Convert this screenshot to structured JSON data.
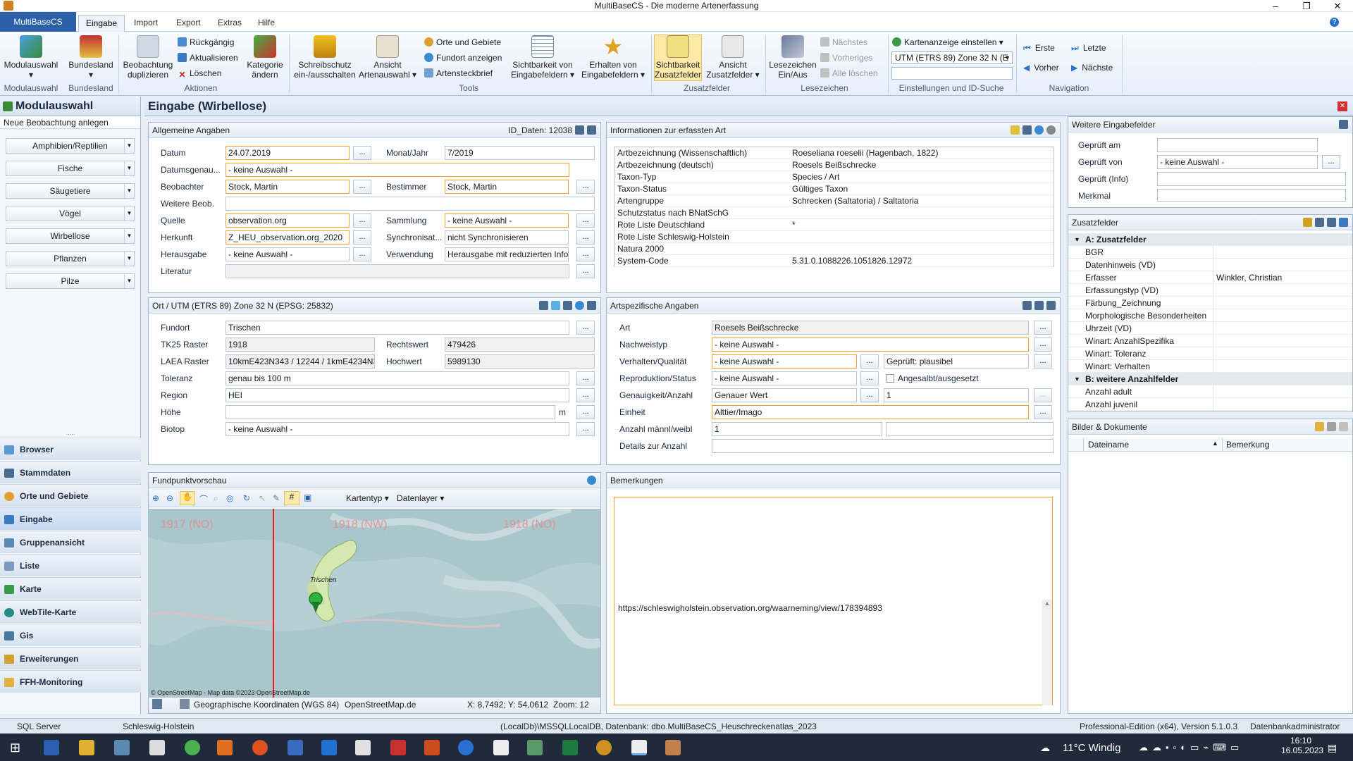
{
  "window": {
    "title": "MultiBaseCS - Die moderne Artenerfassung"
  },
  "ribbon": {
    "file_tab": "MultiBaseCS",
    "tabs": [
      "Eingabe",
      "Import",
      "Export",
      "Extras",
      "Hilfe"
    ],
    "buttons": {
      "modulauswahl": "Modulauswahl",
      "bundesland": "Bundesland",
      "duplizieren_1": "Beobachtung",
      "duplizieren_2": "duplizieren",
      "rueckgaengig": "Rückgängig",
      "aktualisieren": "Aktualisieren",
      "loeschen": "Löschen",
      "kategorie_1": "Kategorie",
      "kategorie_2": "ändern",
      "schreibschutz_1": "Schreibschutz",
      "schreibschutz_2": "ein-/ausschalten",
      "artenauswahl_1": "Ansicht",
      "artenauswahl_2": "Artenauswahl",
      "orte": "Orte und Gebiete",
      "fundort": "Fundort anzeigen",
      "steckbrief": "Artensteckbrief",
      "sichtbarkeit_1": "Sichtbarkeit von",
      "sichtbarkeit_2": "Eingabefeldern",
      "erhalten_1": "Erhalten von",
      "erhalten_2": "Eingabefeldern",
      "sicht_zusatz_1": "Sichtbarkeit",
      "sicht_zusatz_2": "Zusatzfelder",
      "ansicht_zusatz_1": "Ansicht",
      "ansicht_zusatz_2": "Zusatzfelder",
      "lesezeichen_1": "Lesezeichen",
      "lesezeichen_2": "Ein/Aus",
      "naechstes": "Nächstes",
      "vorheriges": "Vorheriges",
      "alle_loeschen": "Alle löschen",
      "karte_einstellen": "Kartenanzeige einstellen",
      "utm": "UTM (ETRS 89) Zone 32 N (E",
      "erste": "Erste",
      "letzte": "Letzte",
      "vorher": "Vorher",
      "naechste": "Nächste"
    },
    "groups": {
      "g1": "Modulauswahl",
      "g2": "Bundesland",
      "g3": "Aktionen",
      "g4": "Tools",
      "g5": "Zusatzfelder",
      "g6": "Lesezeichen",
      "g7": "Einstellungen und ID-Suche",
      "g8": "Navigation"
    }
  },
  "left": {
    "title": "Modulauswahl",
    "new_obs": "Neue Beobachtung anlegen",
    "modules": [
      "Amphibien/Reptilien",
      "Fische",
      "Säugetiere",
      "Vögel",
      "Wirbellose",
      "Pflanzen",
      "Pilze"
    ],
    "nav": [
      "Browser",
      "Stammdaten",
      "Orte und Gebiete",
      "Eingabe",
      "Gruppenansicht",
      "Liste",
      "Karte",
      "WebTile-Karte",
      "Gis",
      "Erweiterungen",
      "FFH-Monitoring"
    ]
  },
  "main": {
    "title": "Eingabe (Wirbellose)"
  },
  "allg": {
    "header": "Allgemeine Angaben",
    "id": "ID_Daten: 12038",
    "labels": {
      "datum": "Datum",
      "monat": "Monat/Jahr",
      "genau": "Datumsgenau...",
      "beob": "Beobachter",
      "best": "Bestimmer",
      "weitere": "Weitere Beob.",
      "quelle": "Quelle",
      "samml": "Sammlung",
      "herkunft": "Herkunft",
      "sync": "Synchronisat...",
      "herausgabe": "Herausgabe",
      "verw": "Verwendung",
      "lit": "Literatur"
    },
    "values": {
      "datum": "24.07.2019",
      "monat": "7/2019",
      "genau": "- keine Auswahl -",
      "beob": "Stock, Martin",
      "best": "Stock, Martin",
      "quelle": "observation.org",
      "samml": "- keine Auswahl -",
      "herkunft": "Z_HEU_observation.org_2020",
      "sync": "nicht Synchronisieren",
      "herausgabe": "- keine Auswahl -",
      "verw": "Herausgabe mit reduzierten Info"
    }
  },
  "info": {
    "header": "Informationen zur erfassten Art",
    "rows": [
      {
        "k": "Artbezeichnung (Wissenschaftlich)",
        "v": "Roeseliana roeselii (Hagenbach, 1822)"
      },
      {
        "k": "Artbezeichnung (deutsch)",
        "v": "Roesels Beißschrecke"
      },
      {
        "k": "Taxon-Typ",
        "v": "Species / Art"
      },
      {
        "k": "Taxon-Status",
        "v": "Gültiges Taxon"
      },
      {
        "k": "Artengruppe",
        "v": "Schrecken (Saltatoria) / Saltatoria"
      },
      {
        "k": "Schutzstatus nach BNatSchG",
        "v": ""
      },
      {
        "k": "Rote Liste Deutschland",
        "v": "*"
      },
      {
        "k": "Rote Liste Schleswig-Holstein",
        "v": ""
      },
      {
        "k": "Natura 2000",
        "v": ""
      },
      {
        "k": "System-Code",
        "v": "5.31.0.1088226.1051826.12972"
      }
    ]
  },
  "ort": {
    "header": "Ort / UTM (ETRS 89) Zone 32 N (EPSG: 25832)",
    "labels": {
      "fundort": "Fundort",
      "tk25": "TK25 Raster",
      "rechts": "Rechtswert",
      "laea": "LAEA Raster",
      "hoch": "Hochwert",
      "tol": "Toleranz",
      "region": "Region",
      "hoehe": "Höhe",
      "biotop": "Biotop",
      "m": "m"
    },
    "values": {
      "fundort": "Trischen",
      "tk25": "1918",
      "rechts": "479426",
      "laea": "10kmE423N343 / 12244 / 1kmE4234N34",
      "hoch": "5989130",
      "tol": "genau bis 100 m",
      "region": "HEI",
      "biotop": "- keine Auswahl -"
    }
  },
  "art": {
    "header": "Artspezifische Angaben",
    "labels": {
      "art": "Art",
      "nachweis": "Nachweistyp",
      "verhalten": "Verhalten/Qualität",
      "repro": "Reproduktion/Status",
      "genau": "Genauigkeit/Anzahl",
      "einheit": "Einheit",
      "anzahl": "Anzahl männl/weibl",
      "details": "Details zur Anzahl",
      "angesalbt": "Angesalbt/ausgesetzt"
    },
    "values": {
      "art": "Roesels Beißschrecke",
      "nachweis": "- keine Auswahl -",
      "verhalten": "- keine Auswahl -",
      "geprueft": "Geprüft: plausibel",
      "repro": "- keine Auswahl -",
      "genau": "Genauer Wert",
      "genau_n": "1",
      "einheit": "Alttier/Imago",
      "anzahl_m": "1"
    }
  },
  "weitere": {
    "header": "Weitere Eingabefelder",
    "labels": {
      "am": "Geprüft am",
      "von": "Geprüft von",
      "info": "Geprüft (Info)",
      "merkmal": "Merkmal"
    },
    "values": {
      "von": "- keine Auswahl -"
    }
  },
  "zusatz": {
    "header": "Zusatzfelder",
    "rows": [
      {
        "k": "A: Zusatzfelder",
        "v": "",
        "cat": true
      },
      {
        "k": "BGR",
        "v": ""
      },
      {
        "k": "Datenhinweis (VD)",
        "v": ""
      },
      {
        "k": "Erfasser",
        "v": "Winkler, Christian"
      },
      {
        "k": "Erfassungstyp (VD)",
        "v": ""
      },
      {
        "k": "Färbung_Zeichnung",
        "v": ""
      },
      {
        "k": "Morphologische Besonderheiten",
        "v": ""
      },
      {
        "k": "Uhrzeit (VD)",
        "v": ""
      },
      {
        "k": "Winart: AnzahlSpezifika",
        "v": ""
      },
      {
        "k": "Winart: Toleranz",
        "v": ""
      },
      {
        "k": "Winart: Verhalten",
        "v": ""
      },
      {
        "k": "B: weitere Anzahlfelder",
        "v": "",
        "cat": true
      },
      {
        "k": "Anzahl adult",
        "v": ""
      },
      {
        "k": "Anzahl juvenil",
        "v": ""
      }
    ]
  },
  "bilder": {
    "header": "Bilder & Dokumente",
    "col1": "Dateiname",
    "col2": "Bemerkung"
  },
  "map": {
    "header": "Fundpunktvorschau",
    "kartentyp": "Kartentyp",
    "datenlayer": "Datenlayer",
    "labels": [
      "1917 (NO)",
      "1918 (NW)",
      "1918 (NO)"
    ],
    "place": "Trischen",
    "attribution": "© OpenStreetMap - Map data ©2023 OpenStreetMap.de",
    "coords_type": "Geographische Koordinaten (WGS 84)",
    "provider": "OpenStreetMap.de",
    "xy": "X: 8,7492; Y: 54,0612",
    "zoom": "Zoom: 12"
  },
  "bem": {
    "header": "Bemerkungen",
    "text": "https://schleswigholstein.observation.org/waarneming/view/178394893"
  },
  "status": {
    "db": "SQL Server",
    "land": "Schleswig-Holstein",
    "conn": "(LocalDb)\\MSSQLLocalDB, Datenbank: dbo.MultiBaseCS_Heuschreckenatlas_2023",
    "edition": "Professional-Edition (x64), Version 5.1.0.3",
    "role": "Datenbankadministrator"
  },
  "taskbar": {
    "weather": "11°C  Windig",
    "time": "16:10",
    "date": "16.05.2023"
  },
  "colors": {
    "accent": "#2b5fa8",
    "required": "#f0a030",
    "pin": "#2fb040",
    "gridline": "#e02020"
  }
}
